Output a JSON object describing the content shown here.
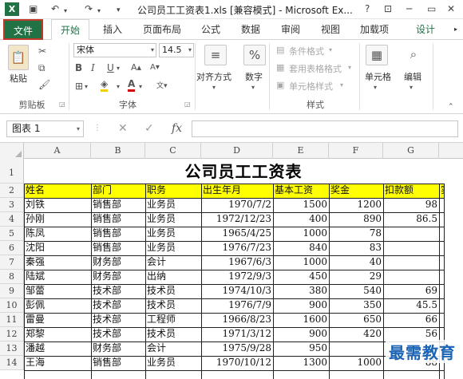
{
  "window": {
    "title": "公司员工工资表1.xls  [兼容模式] - Microsoft Ex...",
    "logo": "X",
    "help": "?"
  },
  "tabs": [
    {
      "label": "文件"
    },
    {
      "label": "开始"
    },
    {
      "label": "插入"
    },
    {
      "label": "页面布局"
    },
    {
      "label": "公式"
    },
    {
      "label": "数据"
    },
    {
      "label": "审阅"
    },
    {
      "label": "视图"
    },
    {
      "label": "加载项"
    },
    {
      "label": "设计"
    }
  ],
  "ribbon": {
    "clipboard": {
      "paste": "粘贴",
      "group": "剪贴板"
    },
    "font": {
      "name": "宋体",
      "size": "14.5",
      "group": "字体",
      "bold": "B",
      "italic": "I",
      "underline": "U"
    },
    "alignment": {
      "label": "对齐方式"
    },
    "number": {
      "label": "数字",
      "symbol": "%"
    },
    "styles": {
      "conditional": "条件格式",
      "table_format": "套用表格格式",
      "cell_style": "单元格样式",
      "group": "样式"
    },
    "cells": {
      "label": "单元格"
    },
    "editing": {
      "label": "编辑"
    }
  },
  "formula_bar": {
    "name_box": "图表 1",
    "fx": "fx",
    "cancel": "✕",
    "enter": "✓",
    "value": ""
  },
  "sheet": {
    "columns": [
      "A",
      "B",
      "C",
      "D",
      "E",
      "F",
      "G"
    ],
    "row_numbers": [
      "1",
      "2",
      "3",
      "4",
      "5",
      "6",
      "7",
      "8",
      "9",
      "10",
      "11",
      "12",
      "13",
      "14"
    ],
    "title": "公司员工工资表",
    "headers": [
      "姓名",
      "部门",
      "职务",
      "出生年月",
      "基本工资",
      "奖金",
      "扣款额",
      "实"
    ],
    "rows": [
      [
        "刘铁",
        "销售部",
        "业务员",
        "1970/7/2",
        "1500",
        "1200",
        "98"
      ],
      [
        "孙刚",
        "销售部",
        "业务员",
        "1972/12/23",
        "400",
        "890",
        "86.5"
      ],
      [
        "陈凤",
        "销售部",
        "业务员",
        "1965/4/25",
        "1000",
        "78",
        ""
      ],
      [
        "沈阳",
        "销售部",
        "业务员",
        "1976/7/23",
        "840",
        "83",
        ""
      ],
      [
        "秦强",
        "财务部",
        "会计",
        "1967/6/3",
        "1000",
        "40",
        ""
      ],
      [
        "陆斌",
        "财务部",
        "出纳",
        "1972/9/3",
        "450",
        "29",
        ""
      ],
      [
        "邹蕾",
        "技术部",
        "技术员",
        "1974/10/3",
        "380",
        "540",
        "69"
      ],
      [
        "彭佩",
        "技术部",
        "技术员",
        "1976/7/9",
        "900",
        "350",
        "45.5"
      ],
      [
        "雷曼",
        "技术部",
        "工程师",
        "1966/8/23",
        "1600",
        "650",
        "66"
      ],
      [
        "郑黎",
        "技术部",
        "技术员",
        "1971/3/12",
        "900",
        "420",
        "56"
      ],
      [
        "潘越",
        "财务部",
        "会计",
        "1975/9/28",
        "950",
        "",
        ""
      ],
      [
        "王海",
        "销售部",
        "业务员",
        "1970/10/12",
        "1300",
        "1000",
        "88"
      ]
    ]
  },
  "watermark": "最需教育"
}
